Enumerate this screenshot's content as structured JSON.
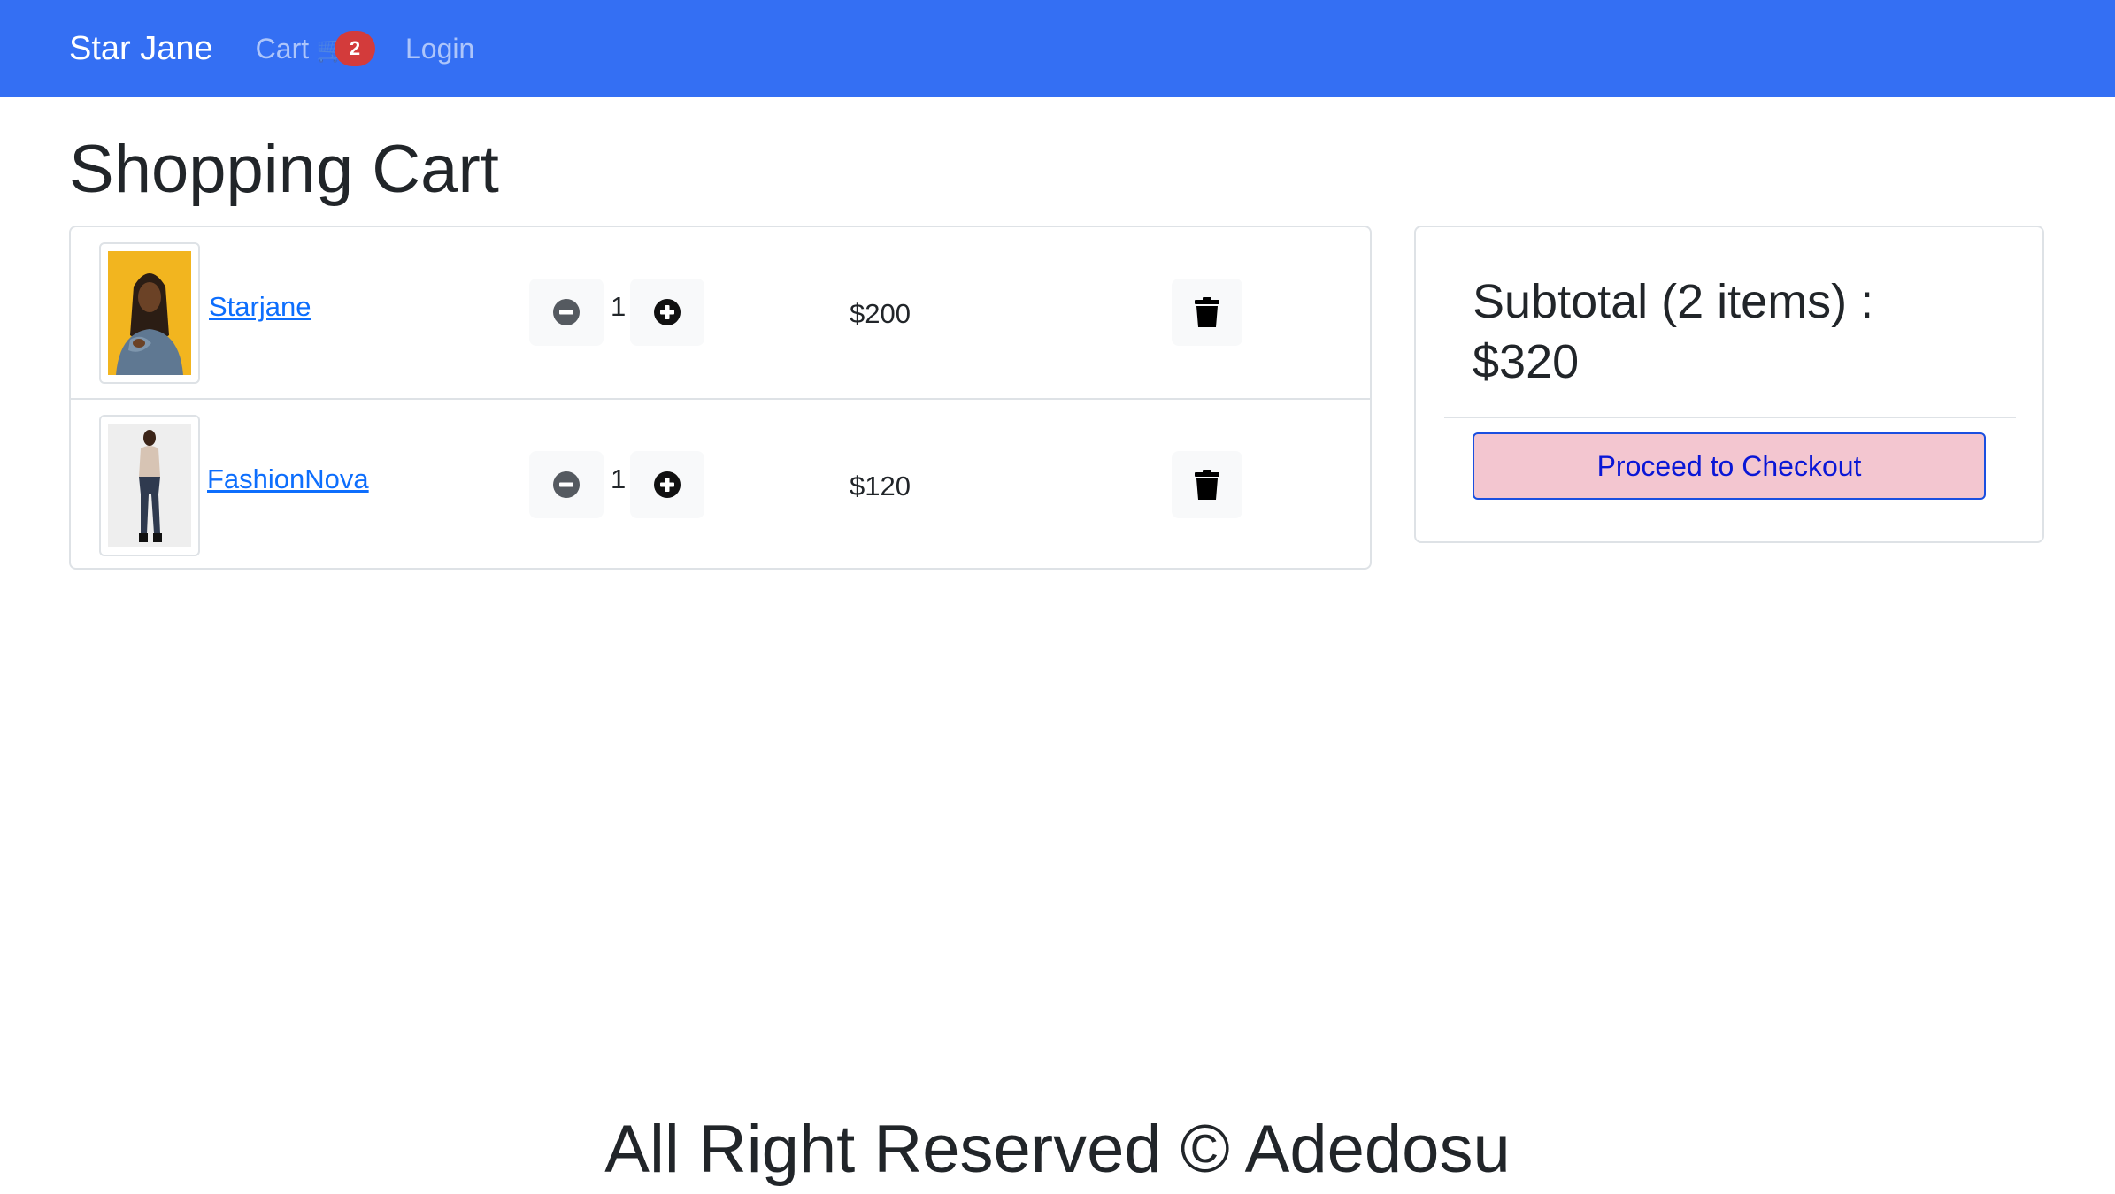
{
  "navbar": {
    "brand": "Star Jane",
    "cart_label": "Cart",
    "cart_count": "2",
    "login_label": "Login"
  },
  "page": {
    "title": "Shopping Cart"
  },
  "cart": {
    "items": [
      {
        "name": "Starjane",
        "quantity": "1",
        "price": "$200"
      },
      {
        "name": "FashionNova",
        "quantity": "1",
        "price": "$120"
      }
    ]
  },
  "summary": {
    "subtotal_label": "Subtotal (2 items) :",
    "subtotal_value": "$320",
    "checkout_label": "Proceed to Checkout"
  },
  "footer": {
    "text": "All Right Reserved © Adedosu"
  },
  "colors": {
    "navbar": "#346ff3",
    "badge": "#d33b3b",
    "link": "#0d6efd",
    "checkout_bg": "#f3c6d0",
    "checkout_border": "#1a4fe0"
  },
  "icons": {
    "cart": "shopping-cart-icon",
    "decrement": "minus-circle-icon",
    "increment": "plus-circle-icon",
    "delete": "trash-icon"
  }
}
